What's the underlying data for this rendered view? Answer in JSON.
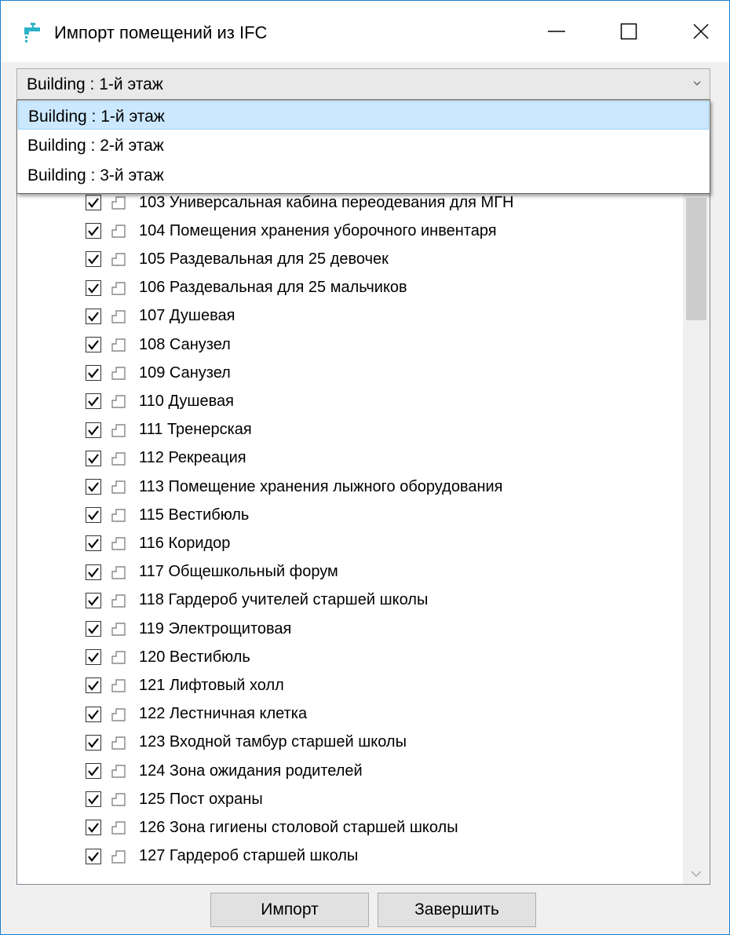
{
  "window": {
    "title": "Импорт помещений из IFC",
    "app_icon": "faucet-icon",
    "controls": [
      "minimize-icon",
      "maximize-icon",
      "close-icon"
    ]
  },
  "combo": {
    "selected": "Building : 1-й этаж",
    "options": [
      "Building : 1-й этаж",
      "Building : 2-й этаж",
      "Building : 3-й этаж"
    ]
  },
  "rooms": [
    "103 Универсальная кабина переодевания для МГН",
    "104 Помещения хранения уборочного инвентаря",
    "105 Раздевальная для 25 девочек",
    "106 Раздевальная для 25 мальчиков",
    "107 Душевая",
    "108 Санузел",
    "109 Санузел",
    "110 Душевая",
    "111 Тренерская",
    "112 Рекреация",
    "113 Помещение хранения лыжного оборудования",
    "115 Вестибюль",
    "116 Коридор",
    "117 Общешкольный форум",
    "118 Гардероб учителей старшей школы",
    "119 Электрощитовая",
    "120 Вестибюль",
    "121 Лифтовый холл",
    "122 Лестничная клетка",
    "123 Входной тамбур старшей школы",
    "124 Зона ожидания родителей",
    "125 Пост охраны",
    "126 Зона гигиены столовой старшей школы",
    "127 Гардероб старшей школы"
  ],
  "buttons": {
    "import": "Импорт",
    "finish": "Завершить"
  },
  "colors": {
    "selection": "#cce8ff",
    "window_border": "#1a7fd4",
    "icon_accent": "#2ab3c8"
  }
}
